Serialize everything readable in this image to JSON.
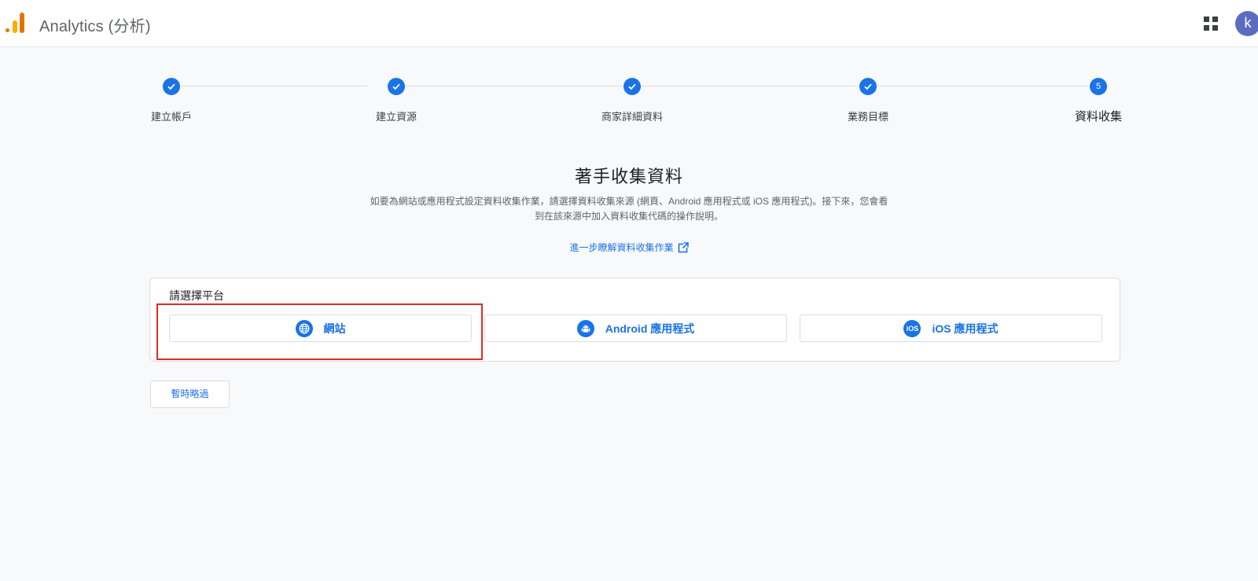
{
  "header": {
    "app_title": "Analytics (分析)",
    "avatar_initial": "k",
    "icons": {
      "logo": "analytics-logo",
      "apps": "apps-grid-icon"
    }
  },
  "steps": [
    {
      "label": "建立帳戶",
      "state": "done"
    },
    {
      "label": "建立資源",
      "state": "done"
    },
    {
      "label": "商家詳細資料",
      "state": "done"
    },
    {
      "label": "業務目標",
      "state": "done"
    },
    {
      "label": "資料收集",
      "state": "current",
      "number": "5"
    }
  ],
  "main": {
    "heading": "著手收集資料",
    "description_line1": "如要為網站或應用程式設定資料收集作業，請選擇資料收集來源 (網頁、Android 應用程式或 iOS 應用程式)。接下來，您會看",
    "description_line2": "到在該來源中加入資料收集代碼的操作說明。",
    "learn_more": "進一步瞭解資料收集作業"
  },
  "platform": {
    "title": "請選擇平台",
    "options": [
      {
        "label": "網站",
        "icon": "globe-icon"
      },
      {
        "label": "Android 應用程式",
        "icon": "android-icon"
      },
      {
        "label": "iOS 應用程式",
        "icon": "ios-icon",
        "icon_text": "iOS"
      }
    ]
  },
  "skip_label": "暫時略過",
  "colors": {
    "accent": "#1a73e8",
    "highlight": "#d93025",
    "background": "#f8f9fb"
  }
}
